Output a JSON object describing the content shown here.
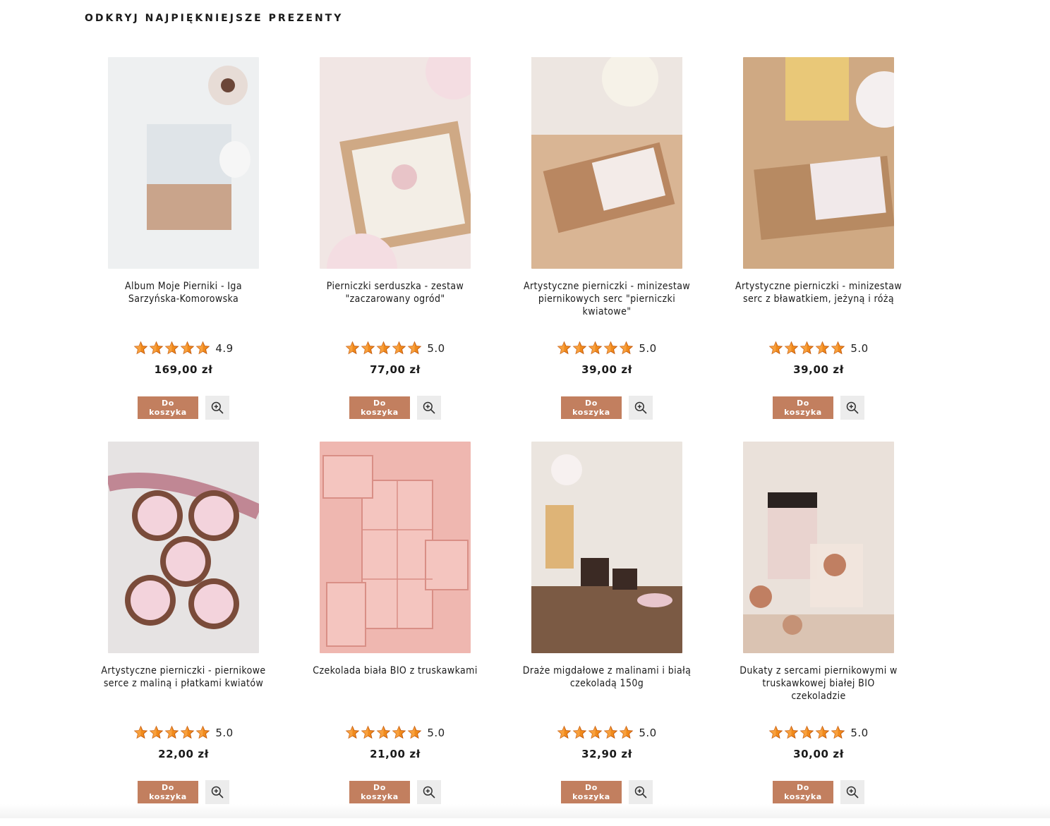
{
  "section_title": "ODKRYJ NAJPIĘKNIEJSZE PREZENTY",
  "accent_color": "#c27f5f",
  "star_color": "#f08a1c",
  "products": [
    {
      "name": "Album Moje Pierniki - Iga Sarzyńska-Komorowska",
      "rating": "4.9",
      "price": "169,00 zł",
      "cart_label": "Do koszyka",
      "image_desc": "album",
      "palette": [
        "#eef0f1",
        "#c9a48b",
        "#b7c2ca"
      ]
    },
    {
      "name": "Pierniczki serduszka - zestaw \"zaczarowany ogród\"",
      "rating": "5.0",
      "price": "77,00 zł",
      "cart_label": "Do koszyka",
      "image_desc": "box-hearts",
      "palette": [
        "#f1e6e4",
        "#cfa985",
        "#e8c4c8"
      ]
    },
    {
      "name": "Artystyczne pierniczki - minizestaw piernikowych serc \"pierniczki kwiatowe\"",
      "rating": "5.0",
      "price": "39,00 zł",
      "cart_label": "Do koszyka",
      "image_desc": "mini-box",
      "palette": [
        "#d9b594",
        "#f2ecea",
        "#c49a7b"
      ]
    },
    {
      "name": "Artystyczne pierniczki - minizestaw serc z bławatkiem, jeżyną i różą",
      "rating": "5.0",
      "price": "39,00 zł",
      "cart_label": "Do koszyka",
      "image_desc": "mini-box-2",
      "palette": [
        "#cfa983",
        "#f0e8e4",
        "#e9c878"
      ]
    },
    {
      "name": "Artystyczne pierniczki - piernikowe serce z maliną i płatkami kwiatów",
      "rating": "5.0",
      "price": "22,00 zł",
      "cart_label": "Do koszyka",
      "image_desc": "hearts",
      "palette": [
        "#e6e3e3",
        "#c08794",
        "#f3d3dc"
      ]
    },
    {
      "name": "Czekolada biała BIO z truskawkami",
      "rating": "5.0",
      "price": "21,00 zł",
      "cart_label": "Do koszyka",
      "image_desc": "chocolate",
      "palette": [
        "#efb7b0",
        "#e7a59c",
        "#f4c5bf"
      ]
    },
    {
      "name": "Draże migdałowe z malinami i białą czekoladą 150g",
      "rating": "5.0",
      "price": "32,90 zł",
      "cart_label": "Do koszyka",
      "image_desc": "jars",
      "palette": [
        "#ebe5df",
        "#7b5a44",
        "#d7a97a"
      ]
    },
    {
      "name": "Dukaty z sercami piernikowymi w truskawkowej białej BIO czekoladzie",
      "rating": "5.0",
      "price": "30,00 zł",
      "cart_label": "Do koszyka",
      "image_desc": "jar-dukaty",
      "palette": [
        "#eae1da",
        "#c07f62",
        "#f0d2cf"
      ]
    }
  ],
  "icons": {
    "star": "star-icon",
    "zoom": "zoom-in-icon"
  }
}
